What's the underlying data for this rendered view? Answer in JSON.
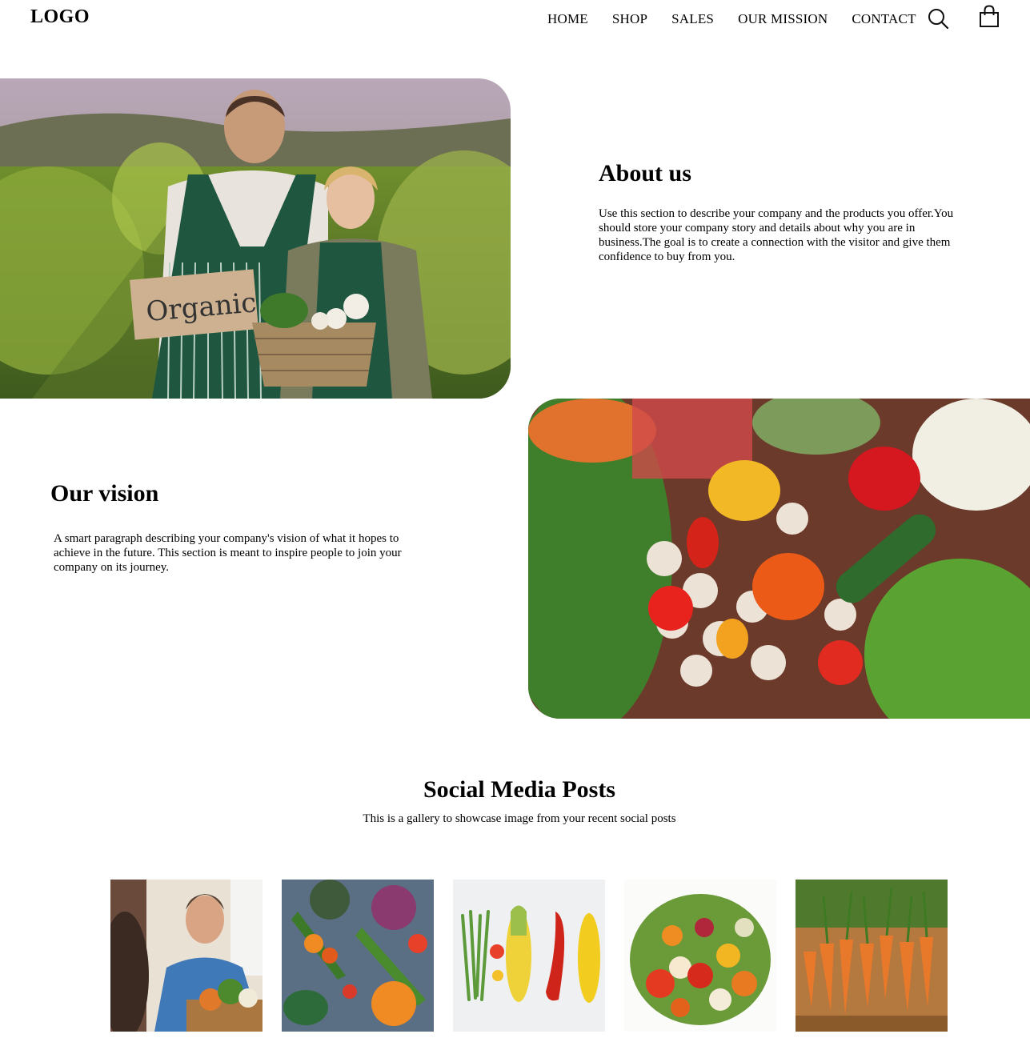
{
  "header": {
    "logo": "LOGO",
    "nav": [
      "HOME",
      "SHOP",
      "SALES",
      "OUR MISSION",
      "CONTACT"
    ],
    "icons": [
      "search-icon",
      "shopping-bag-icon"
    ]
  },
  "about": {
    "title": "About us",
    "text": "Use this section to describe your company and the products you offer.You should store your company story and details about why you are in business.The goal is to create a connection with the visitor and give them confidence to buy from you."
  },
  "vision": {
    "title": "Our vision",
    "text": "A smart paragraph describing your company's vision of what it hopes to achieve in the future. This section is meant to inspire people to join your company on its journey."
  },
  "images": {
    "hero_sign_text": "Organic"
  },
  "social": {
    "title": "Social Media Posts",
    "subtitle": "This is a gallery to showcase image from your recent social posts"
  }
}
